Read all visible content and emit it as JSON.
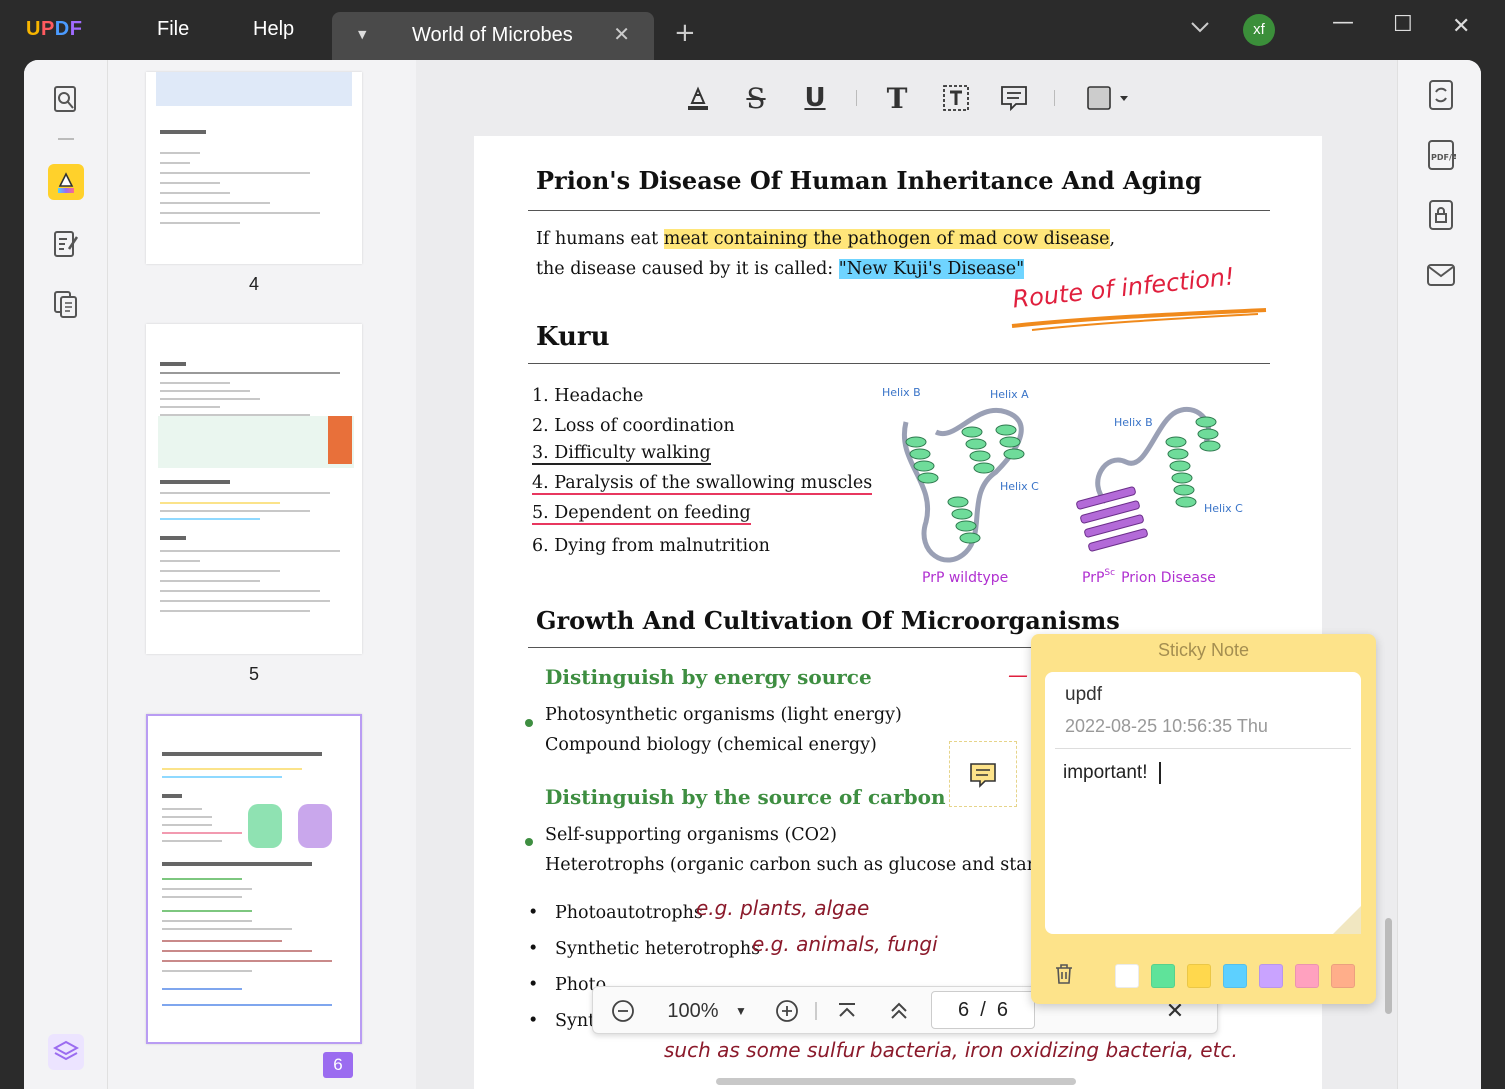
{
  "app": {
    "logo": "UPDF",
    "menu": {
      "file": "File",
      "help": "Help"
    },
    "tab": {
      "title": "World of Microbes"
    },
    "user_initials": "xf"
  },
  "thumbnails": {
    "pages": [
      "4",
      "5",
      "6"
    ],
    "active_page": "6"
  },
  "document": {
    "section1": {
      "title": "Prion's Disease Of Human Inheritance And Aging",
      "line1_pre": "If humans eat ",
      "line1_highlight": "meat containing the pathogen of mad cow disease",
      "line1_post": ",",
      "line2_pre": "the disease caused by it is called: ",
      "line2_highlight": "\"New Kuji's Disease\"",
      "handwritten": "Route of infection!"
    },
    "section2": {
      "title": "Kuru",
      "items": [
        "1. Headache",
        "2. Loss of coordination",
        "3. Difficulty walking",
        "4. Paralysis of the swallowing muscles",
        "5. Dependent on feeding",
        "6. Dying from malnutrition"
      ],
      "figure": {
        "labels": [
          "Helix B",
          "Helix A",
          "Helix C",
          "Helix B",
          "Helix C"
        ],
        "caption_left": "PrP wildtype",
        "caption_right_prefix": "PrP",
        "caption_right_sup": "Sc",
        "caption_right_suffix": "Prion Disease"
      }
    },
    "section3": {
      "title": "Growth And Cultivation Of Microorganisms",
      "sub1": "Distinguish by energy source",
      "sub1_items": [
        "Photosynthetic organisms (light energy)",
        "Compound biology (chemical energy)"
      ],
      "sub2": "Distinguish by the source of carbon",
      "sub2_items": [
        "Self-supporting organisms (CO2)",
        "Heterotrophs (organic carbon such as glucose and starch)"
      ],
      "bullets": [
        {
          "text": "Photoautotrophs",
          "note": "e.g. plants, algae"
        },
        {
          "text": "Synthetic heterotrophs",
          "note": "e.g. animals, fungi"
        },
        {
          "text": "Photo",
          "note": ""
        },
        {
          "text": "Synth",
          "note": ""
        }
      ],
      "bottom_note": "such as some sulfur bacteria, iron oxidizing bacteria, etc."
    }
  },
  "navbar": {
    "zoom": "100%",
    "current_page": "6",
    "separator": "/",
    "total_pages": "6"
  },
  "sticky_note": {
    "title": "Sticky Note",
    "author": "updf",
    "date": "2022-08-25 10:56:35 Thu",
    "content": "important!",
    "colors": [
      "#ffffff",
      "#5fe39a",
      "#ffd84d",
      "#5dd0ff",
      "#c9a3ff",
      "#ffa1bf",
      "#ffae8a"
    ]
  }
}
